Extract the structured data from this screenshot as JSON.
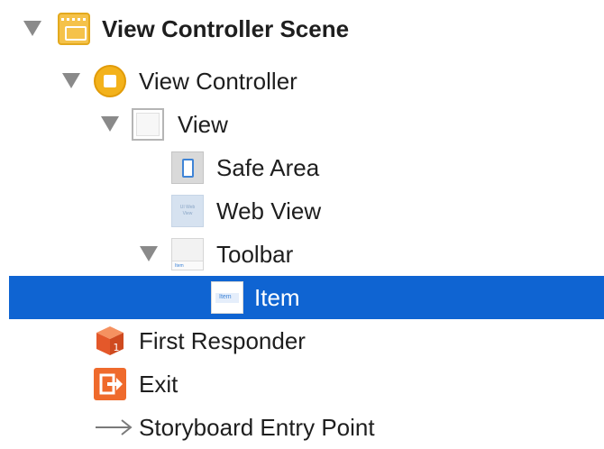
{
  "outline": {
    "scene": {
      "label": "View Controller Scene",
      "icon": "scene-icon",
      "expanded": true
    },
    "view_controller": {
      "label": "View Controller",
      "icon": "view-controller-icon",
      "expanded": true
    },
    "view": {
      "label": "View",
      "icon": "view-icon",
      "expanded": true
    },
    "safe_area": {
      "label": "Safe Area",
      "icon": "safe-area-icon"
    },
    "web_view": {
      "label": "Web View",
      "icon": "web-view-icon",
      "icon_text": "UI Web View"
    },
    "toolbar": {
      "label": "Toolbar",
      "icon": "toolbar-icon",
      "expanded": true,
      "icon_text": "Item"
    },
    "item": {
      "label": "Item",
      "icon": "bar-button-item-icon",
      "icon_text": "Item",
      "selected": true
    },
    "first_responder": {
      "label": "First Responder",
      "icon": "first-responder-icon",
      "icon_text": "1"
    },
    "exit": {
      "label": "Exit",
      "icon": "exit-icon"
    },
    "entry_point": {
      "label": "Storyboard Entry Point",
      "icon": "entry-arrow-icon"
    }
  },
  "colors": {
    "selection": "#0f64d2",
    "disclosure": "#8a8a8a",
    "scene_yellow": "#f5c24a",
    "first_responder_orange": "#ef6a2c"
  }
}
